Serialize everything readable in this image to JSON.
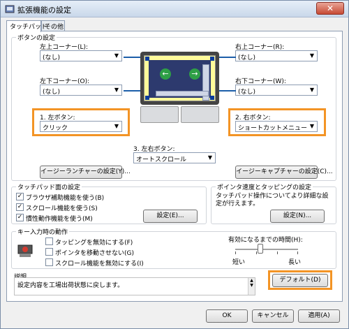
{
  "window": {
    "title": "拡張機能の設定",
    "close": "✕"
  },
  "tabs": [
    {
      "label": "タッチパッド"
    },
    {
      "label": "その他"
    }
  ],
  "buttons_group": {
    "title": "ボタンの設定",
    "top_left": {
      "label": "左上コーナー(L):",
      "value": "(なし)"
    },
    "top_right": {
      "label": "右上コーナー(R):",
      "value": "(なし)"
    },
    "bottom_left": {
      "label": "左下コーナー(O):",
      "value": "(なし)"
    },
    "bottom_right": {
      "label": "右下コーナー(W):",
      "value": "(なし)"
    },
    "left_button": {
      "label": "1. 左ボタン:",
      "value": "クリック"
    },
    "right_button": {
      "label": "2. 右ボタン:",
      "value": "ショートカットメニュー"
    },
    "both_buttons": {
      "label": "3. 左右ボタン:",
      "value": "オートスクロール"
    },
    "easy_launcher": "イージーランチャーの設定(Y)...",
    "easy_capture": "イージーキャプチャーの設定(C)..."
  },
  "surface_group": {
    "title": "タッチパッド面の設定",
    "items": [
      {
        "label": "ブラウザ補助機能を使う(B)",
        "checked": true
      },
      {
        "label": "スクロール機能を使う(S)",
        "checked": true
      },
      {
        "label": "慣性動作機能を使う(M)",
        "checked": true
      }
    ],
    "settings_btn": "設定(E)..."
  },
  "speed_group": {
    "title": "ポインタ速度とタッピングの設定",
    "text": "タッチパッド操作についてより詳細な設定が行えます。",
    "settings_btn": "設定(N)..."
  },
  "key_group": {
    "title": "キー入力時の動作",
    "items": [
      {
        "label": "タッピングを無効にする(F)",
        "checked": false
      },
      {
        "label": "ポインタを移動させない(G)",
        "checked": false
      },
      {
        "label": "スクロール機能を無効にする(I)",
        "checked": false
      }
    ],
    "time_label": "有効になるまでの時間(H):",
    "short": "短い",
    "long": "長い",
    "slider_value": 0.4
  },
  "description": {
    "title": "説明",
    "text": "設定内容を工場出荷状態に戻します。"
  },
  "default_btn": "デフォルト(D)",
  "footer": {
    "ok": "OK",
    "cancel": "キャンセル",
    "apply": "適用(A)"
  }
}
